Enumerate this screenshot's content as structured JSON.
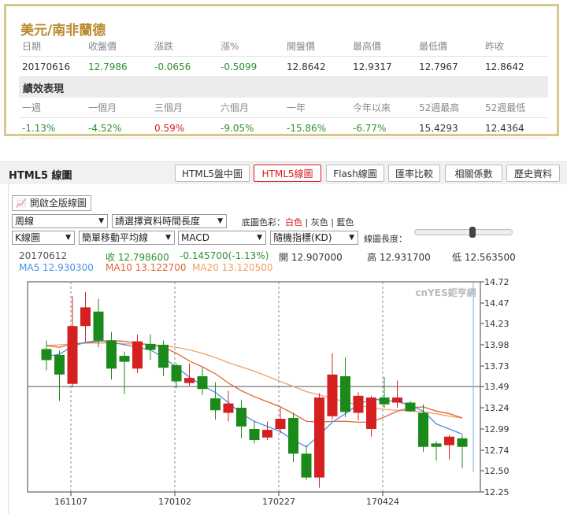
{
  "quote": {
    "title": "美元/南非蘭德",
    "headers": [
      "日期",
      "收盤價",
      "漲跌",
      "漲%",
      "開盤價",
      "最高價",
      "最低價",
      "昨收"
    ],
    "values": [
      "20170616",
      "12.7986",
      "-0.0656",
      "-0.5099",
      "12.8642",
      "12.9317",
      "12.7967",
      "12.8642"
    ],
    "perf_title": "績效表現",
    "perf_headers": [
      "一週",
      "一個月",
      "三個月",
      "六個月",
      "一年",
      "今年以來",
      "52週最高",
      "52週最低"
    ],
    "perf_values": [
      "-1.13%",
      "-4.52%",
      "0.59%",
      "-9.05%",
      "-15.86%",
      "-6.77%",
      "15.4293",
      "12.4364"
    ]
  },
  "chart_header": {
    "title": "HTML5 線圖",
    "tabs": [
      "HTML5盤中圖",
      "HTML5線圖",
      "Flash線圖",
      "匯率比較",
      "相關係數",
      "歷史資料"
    ]
  },
  "controls": {
    "full_button": "開啟全版線圖",
    "period": "周線",
    "range": "請選擇資料時間長度",
    "bg_label": "底圖色彩：",
    "bg_white": "白色",
    "bg_sep1": "|",
    "bg_gray": "灰色",
    "bg_sep2": "|",
    "bg_blue": "藍色",
    "chart_type": "K線圖",
    "ma_type": "簡單移動平均線",
    "indicator": "MACD",
    "kd": "隨機指標(KD)",
    "length_label": "線圖長度："
  },
  "info": {
    "date": "20170612",
    "close": "收 12.798600",
    "change": "-0.145700(-1.13%)",
    "open": "開 12.907000",
    "high": "高 12.931700",
    "low": "低 12.563500",
    "ma5": "MA5 12.930300",
    "ma10": "MA10 13.122700",
    "ma20": "MA20 13.120500"
  },
  "colors": {
    "up": "#d42020",
    "down": "#1a8a1a",
    "ma5": "#4a90e2",
    "ma10": "#e0633a",
    "ma20": "#f0a060",
    "accent": "#b8892d"
  },
  "chart_data": {
    "type": "candlestick",
    "watermark": "cnYES鉅亨網",
    "y_ticks": [
      14.72,
      14.47,
      14.23,
      13.98,
      13.73,
      13.49,
      13.24,
      12.99,
      12.74,
      12.5,
      12.25
    ],
    "ylim": [
      12.25,
      14.72
    ],
    "x_labels": [
      "161107",
      "170102",
      "170227",
      "170424"
    ],
    "reference_line": 13.49,
    "candles": [
      {
        "o": 13.93,
        "c": 13.8,
        "h": 14.03,
        "l": 13.68
      },
      {
        "o": 13.86,
        "c": 13.63,
        "h": 13.91,
        "l": 13.32
      },
      {
        "o": 13.52,
        "c": 14.2,
        "h": 14.55,
        "l": 13.48
      },
      {
        "o": 14.2,
        "c": 14.42,
        "h": 14.6,
        "l": 14.02
      },
      {
        "o": 14.37,
        "c": 14.03,
        "h": 14.52,
        "l": 13.95
      },
      {
        "o": 14.03,
        "c": 13.7,
        "h": 14.13,
        "l": 13.57
      },
      {
        "o": 13.85,
        "c": 13.78,
        "h": 13.9,
        "l": 13.4
      },
      {
        "o": 13.7,
        "c": 14.02,
        "h": 14.1,
        "l": 13.65
      },
      {
        "o": 13.99,
        "c": 13.92,
        "h": 14.1,
        "l": 13.8
      },
      {
        "o": 13.98,
        "c": 13.71,
        "h": 14.03,
        "l": 13.61
      },
      {
        "o": 13.74,
        "c": 13.55,
        "h": 13.76,
        "l": 13.47
      },
      {
        "o": 13.53,
        "c": 13.59,
        "h": 13.76,
        "l": 13.5
      },
      {
        "o": 13.61,
        "c": 13.46,
        "h": 13.71,
        "l": 13.39
      },
      {
        "o": 13.35,
        "c": 13.21,
        "h": 13.54,
        "l": 13.1
      },
      {
        "o": 13.18,
        "c": 13.29,
        "h": 13.44,
        "l": 13.08
      },
      {
        "o": 13.24,
        "c": 13.02,
        "h": 13.33,
        "l": 12.88
      },
      {
        "o": 12.99,
        "c": 12.86,
        "h": 13.08,
        "l": 12.82
      },
      {
        "o": 12.89,
        "c": 12.98,
        "h": 13.08,
        "l": 12.86
      },
      {
        "o": 12.99,
        "c": 13.11,
        "h": 13.24,
        "l": 12.94
      },
      {
        "o": 13.12,
        "c": 12.7,
        "h": 13.18,
        "l": 12.6
      },
      {
        "o": 12.7,
        "c": 12.42,
        "h": 12.8,
        "l": 12.39
      },
      {
        "o": 12.42,
        "c": 13.36,
        "h": 13.41,
        "l": 12.3
      },
      {
        "o": 13.14,
        "c": 13.63,
        "h": 13.88,
        "l": 13.1
      },
      {
        "o": 13.61,
        "c": 13.19,
        "h": 13.83,
        "l": 13.13
      },
      {
        "o": 13.18,
        "c": 13.38,
        "h": 13.42,
        "l": 13.09
      },
      {
        "o": 12.99,
        "c": 13.36,
        "h": 13.38,
        "l": 12.9
      },
      {
        "o": 13.36,
        "c": 13.28,
        "h": 13.6,
        "l": 13.24
      },
      {
        "o": 13.3,
        "c": 13.36,
        "h": 13.56,
        "l": 13.24
      },
      {
        "o": 13.3,
        "c": 13.2,
        "h": 13.32,
        "l": 13.19
      },
      {
        "o": 13.18,
        "c": 12.78,
        "h": 13.28,
        "l": 12.72
      },
      {
        "o": 12.82,
        "c": 12.78,
        "h": 12.85,
        "l": 12.62
      },
      {
        "o": 12.8,
        "c": 12.9,
        "h": 12.92,
        "l": 12.63
      },
      {
        "o": 12.88,
        "c": 12.78,
        "h": 12.92,
        "l": 12.53
      }
    ],
    "ma5": [
      13.84,
      13.87,
      13.96,
      14.01,
      14.03,
      14.01,
      13.98,
      13.95,
      13.92,
      13.83,
      13.72,
      13.6,
      13.5,
      13.42,
      13.3,
      13.17,
      13.08,
      13.02,
      12.96,
      12.86,
      12.78,
      12.92,
      13.07,
      13.17,
      13.28,
      13.34,
      13.33,
      13.31,
      13.27,
      13.2,
      13.05,
      12.99,
      12.93
    ],
    "ma10": [
      13.97,
      13.95,
      13.99,
      14.0,
      14.02,
      14.03,
      14.02,
      14.0,
      13.98,
      13.95,
      13.88,
      13.79,
      13.72,
      13.64,
      13.53,
      13.44,
      13.37,
      13.31,
      13.25,
      13.17,
      13.08,
      13.07,
      13.08,
      13.08,
      13.07,
      13.07,
      13.13,
      13.2,
      13.24,
      13.25,
      13.2,
      13.17,
      13.12
    ],
    "ma20": [
      13.97,
      13.98,
      13.99,
      14.0,
      14.0,
      14.0,
      13.99,
      13.99,
      13.98,
      13.97,
      13.95,
      13.92,
      13.88,
      13.83,
      13.77,
      13.72,
      13.67,
      13.61,
      13.55,
      13.49,
      13.43,
      13.39,
      13.35,
      13.31,
      13.27,
      13.24,
      13.22,
      13.21,
      13.2,
      13.19,
      13.17,
      13.14,
      13.12
    ]
  }
}
